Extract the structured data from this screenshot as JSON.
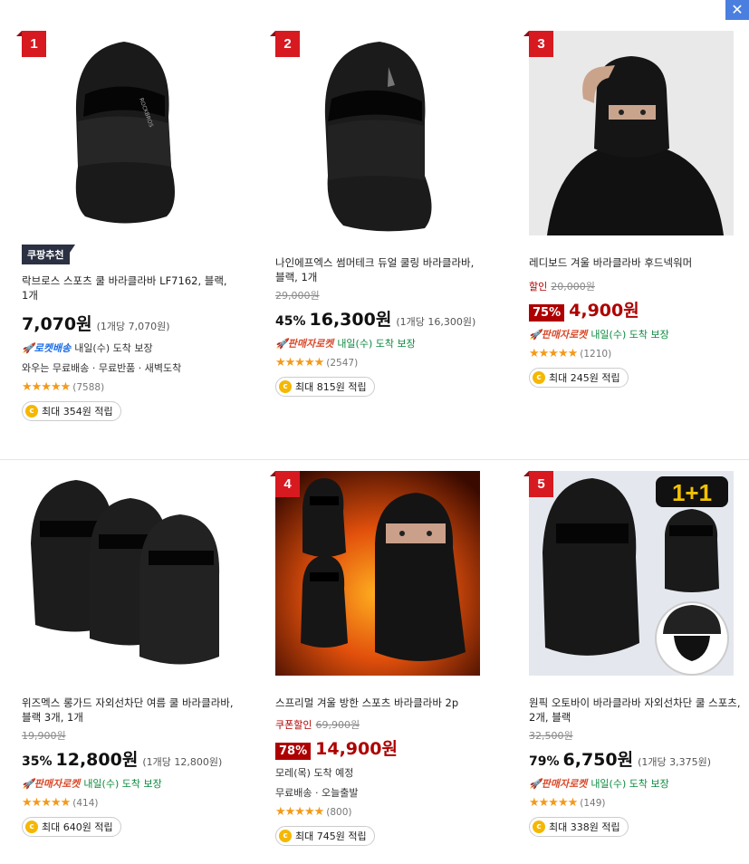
{
  "close_label": "✕",
  "products": [
    {
      "rank": "1",
      "badge": "쿠팡추천",
      "title": "락브로스 스포츠 쿨 바라클라바 LF7162, 블랙, 1개",
      "orig_price": "",
      "sale_label": "",
      "discount": "",
      "price": "7,070원",
      "unit_price": "(1개당 7,070원)",
      "delivery_badge": "로켓배송",
      "delivery_text": "내일(수) 도착 보장",
      "extra": "와우는 무료배송 · 무료반품 · 새벽도착",
      "stars": "★★★★★",
      "rating": 4.5,
      "reviews": "(7588)",
      "points": "최대 354원 적립"
    },
    {
      "rank": "2",
      "badge": "",
      "title": "나인에프엑스 썸머테크 듀얼 쿨링 바라클라바, 블랙, 1개",
      "orig_price": "29,000원",
      "sale_label": "",
      "discount": "45%",
      "price": "16,300원",
      "unit_price": "(1개당 16,300원)",
      "delivery_badge": "판매자로켓",
      "delivery_text": "내일(수) 도착 보장",
      "extra": "",
      "stars": "★★★★★",
      "rating": 4.5,
      "reviews": "(2547)",
      "points": "최대 815원 적립"
    },
    {
      "rank": "3",
      "badge": "",
      "title": "레디보드 겨울 바라클라바 후드넥워머",
      "orig_price": "20,000원",
      "sale_label": "할인",
      "discount": "75%",
      "price": "4,900원",
      "unit_price": "",
      "delivery_badge": "판매자로켓",
      "delivery_text": "내일(수) 도착 보장",
      "extra": "",
      "stars": "★★★★★",
      "rating": 5,
      "reviews": "(1210)",
      "points": "최대 245원 적립"
    },
    {
      "rank": "",
      "badge": "",
      "title": "위즈멕스 롱가드 자외선차단 여름 쿨 바라클라바, 블랙 3개, 1개",
      "orig_price": "19,900원",
      "sale_label": "",
      "discount": "35%",
      "price": "12,800원",
      "unit_price": "(1개당 12,800원)",
      "delivery_badge": "판매자로켓",
      "delivery_text": "내일(수) 도착 보장",
      "extra": "",
      "stars": "★★★★★",
      "rating": 4.5,
      "reviews": "(414)",
      "points": "최대 640원 적립"
    },
    {
      "rank": "4",
      "badge": "",
      "title": "스프리멀 겨울 방한 스포츠 바라클라바 2p",
      "orig_price": "69,900원",
      "sale_label": "쿠폰할인",
      "discount": "78%",
      "price": "14,900원",
      "unit_price": "",
      "delivery_badge": "",
      "delivery_text": "",
      "extra": "모레(목) 도착 예정",
      "extra2": "무료배송 · 오늘출발",
      "stars": "★★★★★",
      "rating": 5,
      "reviews": "(800)",
      "points": "최대 745원 적립"
    },
    {
      "rank": "5",
      "badge": "",
      "title": "원픽 오토바이 바라클라바 자외선차단 쿨 스포츠, 2개, 블랙",
      "orig_price": "32,500원",
      "sale_label": "",
      "discount": "79%",
      "price": "6,750원",
      "unit_price": "(1개당 3,375원)",
      "delivery_badge": "판매자로켓",
      "delivery_text": "내일(수) 도착 보장",
      "extra": "",
      "stars": "★★★★★",
      "rating": 4.5,
      "reviews": "(149)",
      "points": "최대 338원 적립"
    }
  ],
  "promo_text": "1+1"
}
